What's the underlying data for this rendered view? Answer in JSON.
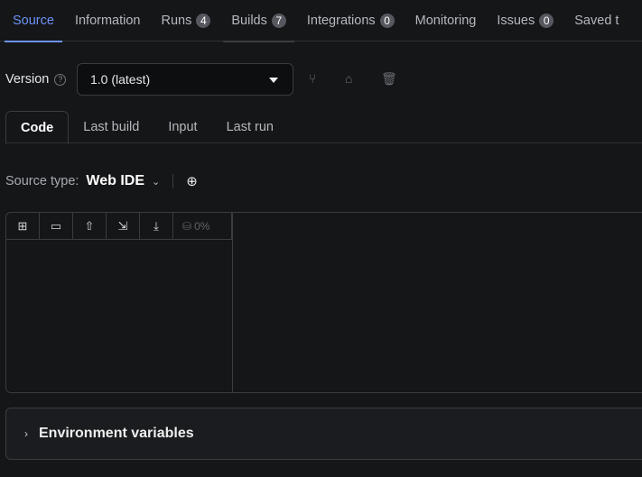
{
  "tabs": [
    {
      "label": "Source",
      "active": true
    },
    {
      "label": "Information"
    },
    {
      "label": "Runs",
      "badge": "4"
    },
    {
      "label": "Builds",
      "badge": "7"
    },
    {
      "label": "Integrations",
      "badge": "0"
    },
    {
      "label": "Monitoring"
    },
    {
      "label": "Issues",
      "badge": "0"
    },
    {
      "label": "Saved t"
    }
  ],
  "version": {
    "label": "Version",
    "help": "?",
    "selected": "1.0 (latest)"
  },
  "subtabs": [
    "Code",
    "Last build",
    "Input",
    "Last run"
  ],
  "source_type": {
    "label": "Source type:",
    "value": "Web IDE"
  },
  "ide": {
    "storage_percent": "0%"
  },
  "env": {
    "title": "Environment variables"
  },
  "colors": {
    "accent": "#6c93f7",
    "background": "#151618"
  }
}
